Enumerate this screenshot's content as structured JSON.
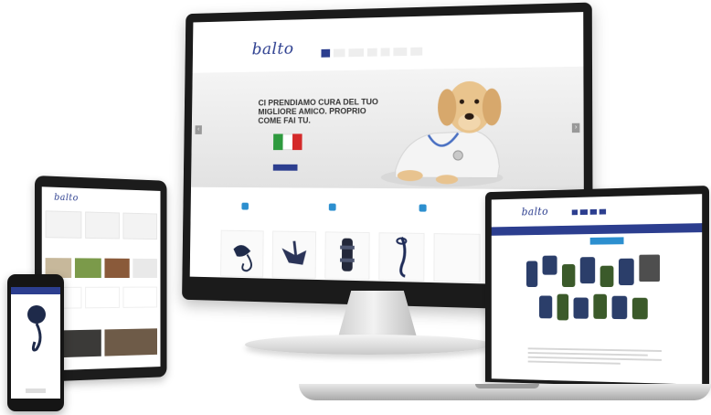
{
  "colors": {
    "brand_blue": "#2c3e8f",
    "accent_blue": "#2c8fcf",
    "device_black": "#1b1b1b",
    "silver": "#cfcfcf",
    "flag_green": "#2e9a3e",
    "flag_white": "#ffffff",
    "flag_red": "#d42a2a"
  },
  "monitor": {
    "logo": "balto",
    "hero_title": "CI PRENDIAMO CURA DEL TUO MIGLIORE AMICO. PROPRIO COME FAI TU."
  },
  "laptop": {
    "logo": "balto"
  },
  "tablet": {
    "logo": "balto"
  },
  "icons": [
    "dog-illustration",
    "italian-flag-icon",
    "product-collar-icon",
    "product-harness-icon",
    "product-brace-icon",
    "product-leash-icon"
  ]
}
